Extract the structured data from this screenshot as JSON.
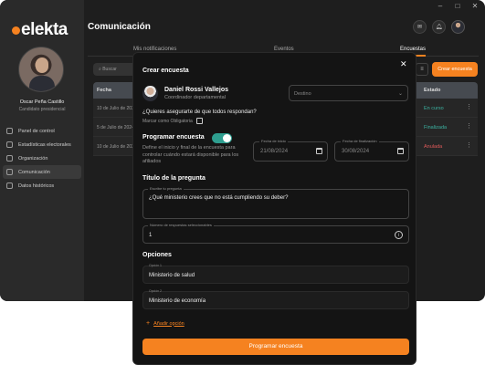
{
  "window": {
    "controls": [
      "–",
      "□",
      "✕"
    ]
  },
  "brand": {
    "logo": "elekta"
  },
  "user": {
    "name": "Oscar Peña Castillo",
    "role": "Candidato presidencial"
  },
  "sidebar": {
    "items": [
      {
        "label": "Panel de control",
        "icon": "dashboard-icon",
        "active": false
      },
      {
        "label": "Estadísticas electorales",
        "icon": "chart-icon",
        "active": false
      },
      {
        "label": "Organización",
        "icon": "org-icon",
        "active": false
      },
      {
        "label": "Comunicación",
        "icon": "chat-icon",
        "active": true
      },
      {
        "label": "Datos históricos",
        "icon": "history-icon",
        "active": false
      }
    ]
  },
  "header": {
    "title": "Comunicación"
  },
  "tabs": [
    {
      "label": "Mis notificaciones",
      "active": false
    },
    {
      "label": "Eventos",
      "active": false
    },
    {
      "label": "Encuestas",
      "active": true
    }
  ],
  "toolbar": {
    "search_placeholder": "Buscar",
    "create_label": "Crear encuesta"
  },
  "table": {
    "headers": [
      "Fecha",
      "Estado"
    ],
    "rows": [
      {
        "date": "10 de Julio de 2024",
        "status": "En curso",
        "status_color": "#3bb3a2"
      },
      {
        "date": "5 de Julio de 2024",
        "status": "Finalizada",
        "status_color": "#3bb3a2"
      },
      {
        "date": "10 de Julio de 2024",
        "status": "Anulada",
        "status_color": "#e05a5a"
      }
    ]
  },
  "modal": {
    "title": "Crear encuesta",
    "author": {
      "name": "Daniel Rossi Vallejos",
      "role": "Coordinador departamental"
    },
    "destino_placeholder": "Destino",
    "question_answer": "¿Quieres asegurarte de que todos respondan?",
    "mandatory_label": "Marcar como Obligatoria",
    "schedule": {
      "label": "Programar encuesta",
      "description": "Define el inicio y final de la encuesta para controlar cuándo estará disponible para los afiliados",
      "start_label": "Fecha de inicio",
      "start_value": "21/08/2024",
      "end_label": "Fecha de finalización",
      "end_value": "30/08/2024"
    },
    "question_section": "Título de la pregunta",
    "question_label": "Escribe tu pregunta",
    "question_value": "¿Qué ministerio crees que no está cumpliendo su deber?",
    "responses_label": "Número de respuestas seleccionables",
    "responses_value": "1",
    "options_section": "Opciones",
    "options": [
      {
        "label": "Opción 1",
        "value": "Ministerio de salud"
      },
      {
        "label": "Opción 2",
        "value": "Ministerio de economía"
      }
    ],
    "add_option": "Añadir opción",
    "submit_label": "Programar encuesta"
  },
  "colors": {
    "accent": "#f58220",
    "toggle_on": "#2e9e8f",
    "background": "#1e1e1e"
  }
}
